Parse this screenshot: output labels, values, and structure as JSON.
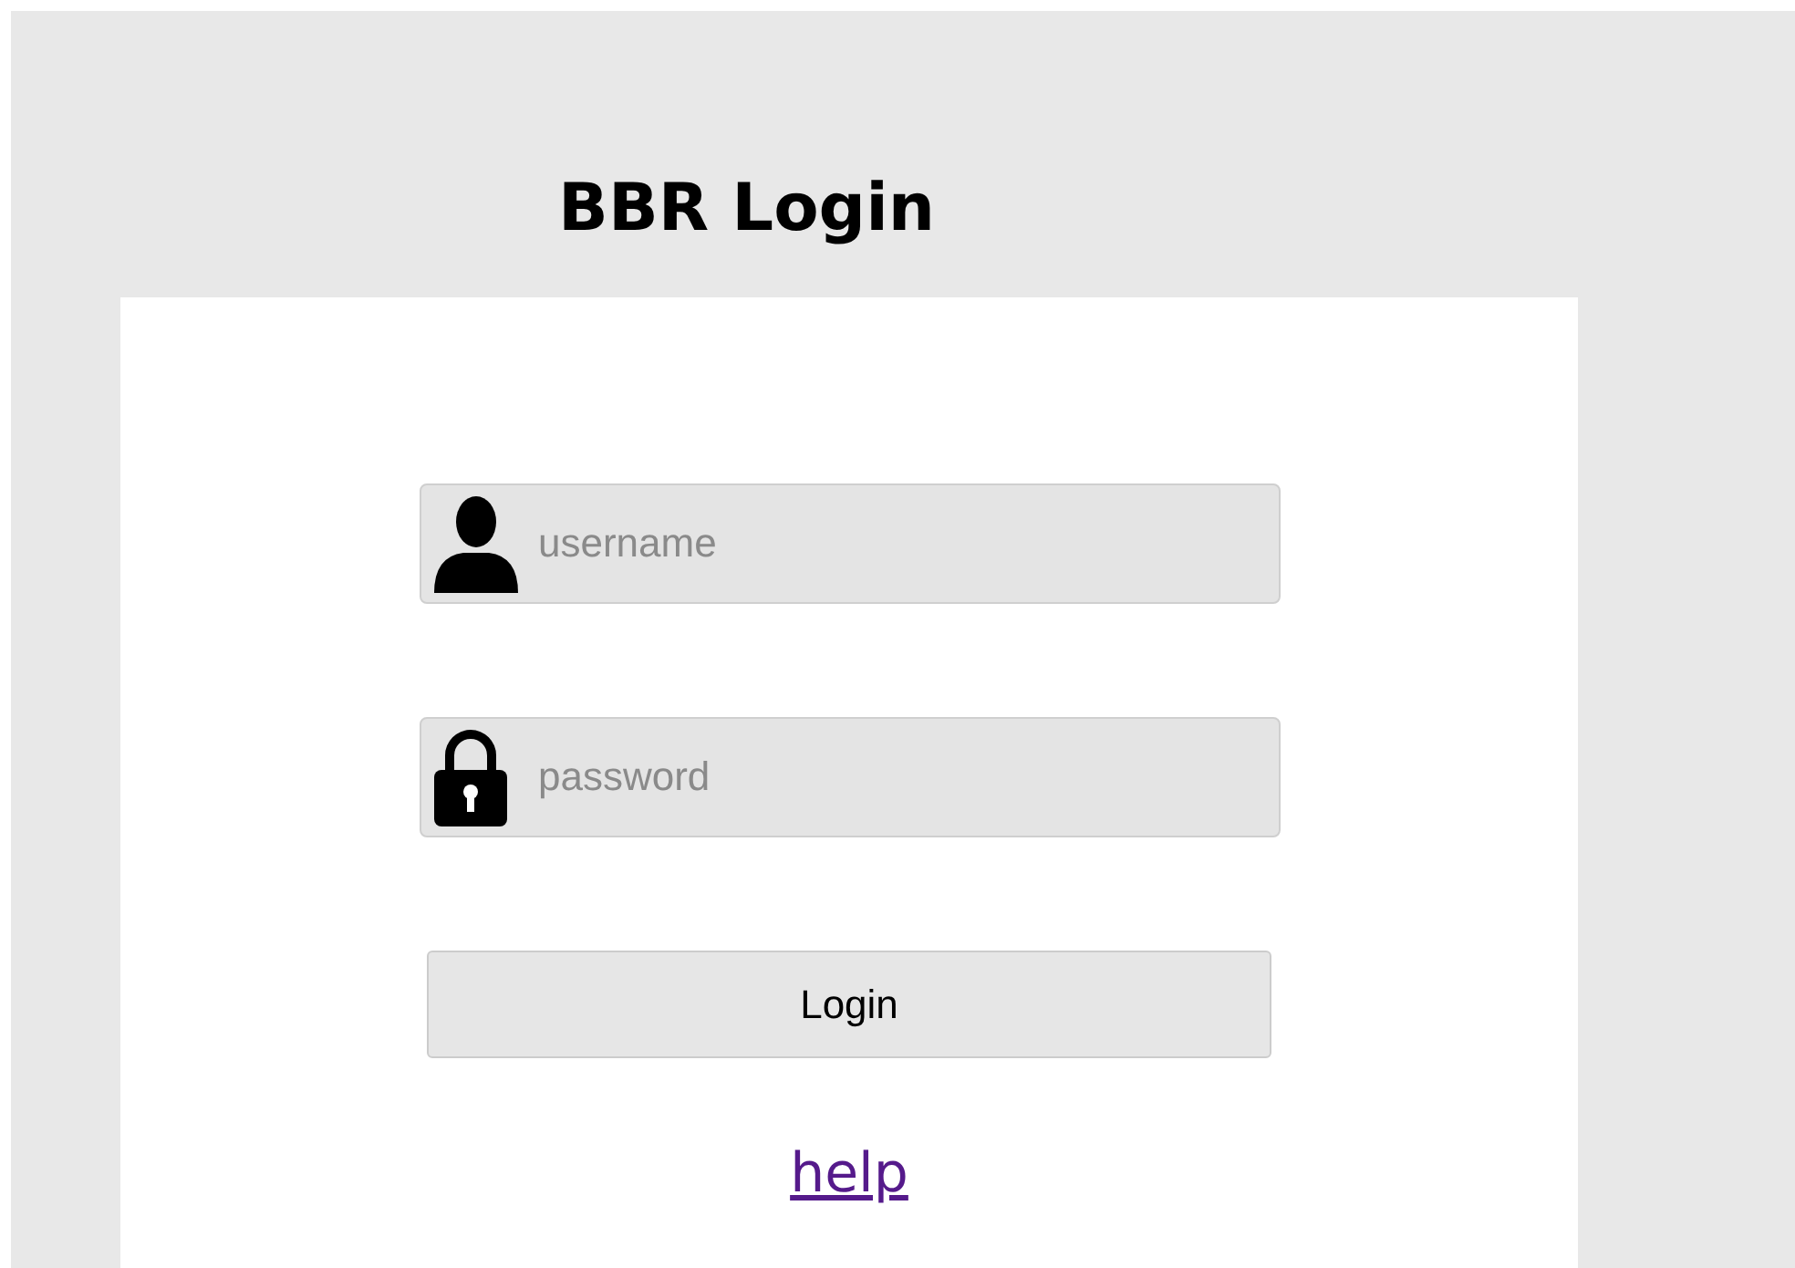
{
  "title": "BBR Login",
  "fields": [
    {
      "kind": "user",
      "placeholder": "username"
    },
    {
      "kind": "password",
      "placeholder": "password"
    }
  ],
  "button": "Login",
  "link": "help"
}
